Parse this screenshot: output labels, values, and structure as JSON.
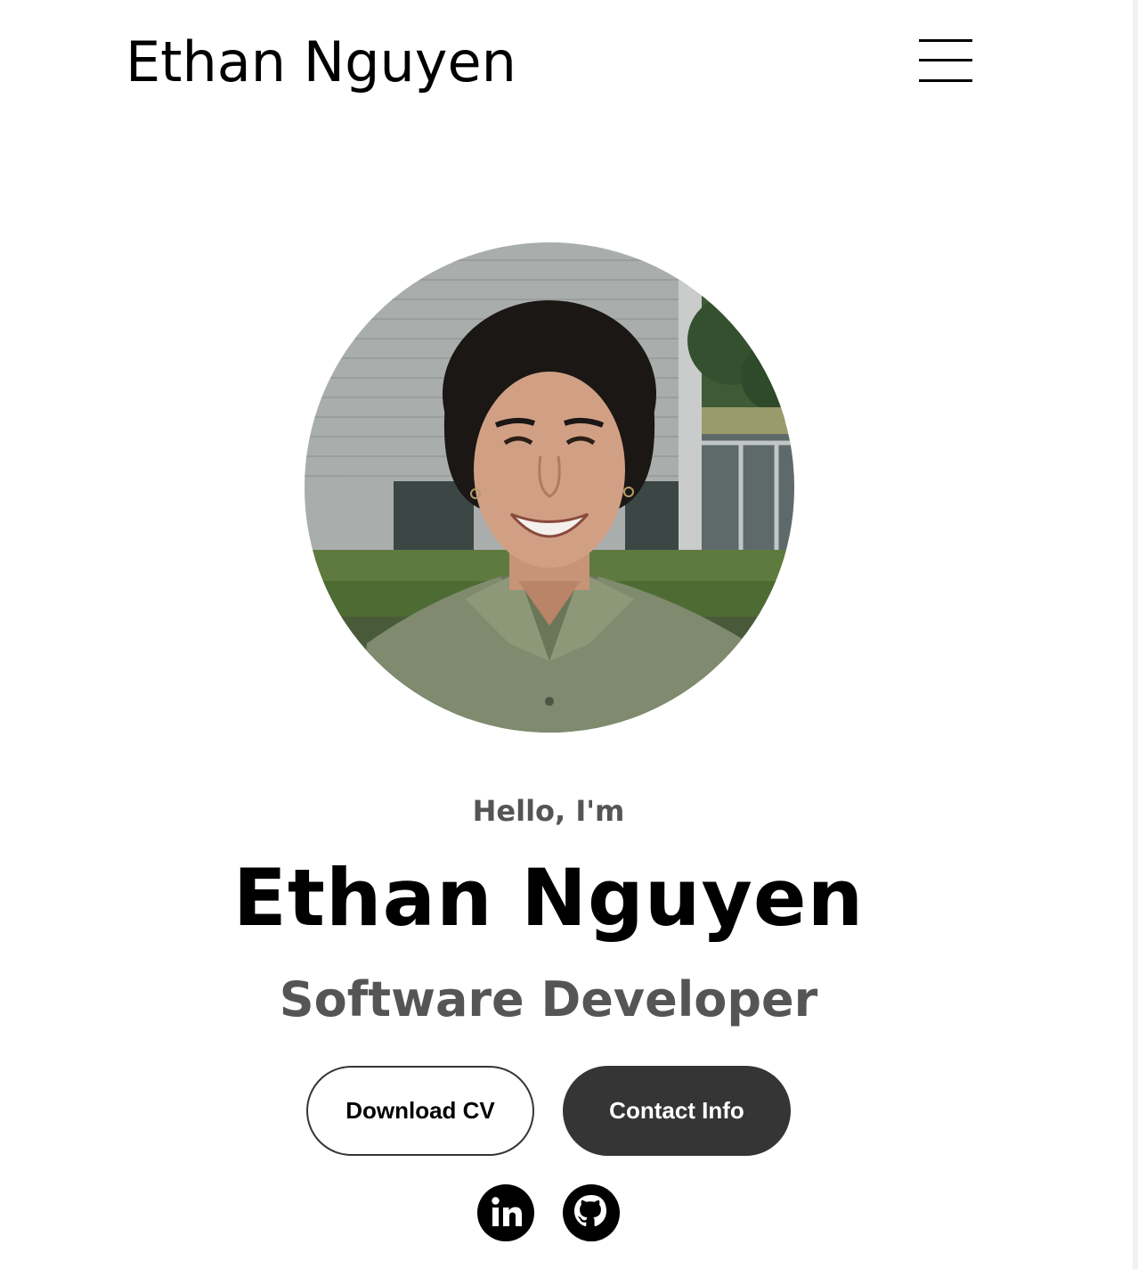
{
  "nav": {
    "logo": "Ethan Nguyen",
    "menu_icon": "hamburger-menu-icon"
  },
  "hero": {
    "profile_image_alt": "Profile picture",
    "greeting": "Hello, I'm",
    "name": "Ethan Nguyen",
    "title": "Software Developer",
    "buttons": {
      "download_cv": "Download CV",
      "contact_info": "Contact Info"
    },
    "socials": [
      {
        "icon": "linkedin-icon"
      },
      {
        "icon": "github-icon"
      }
    ]
  },
  "colors": {
    "primary_text": "#000000",
    "secondary_text": "#555555",
    "button_dark": "#353535",
    "background": "#ffffff"
  }
}
